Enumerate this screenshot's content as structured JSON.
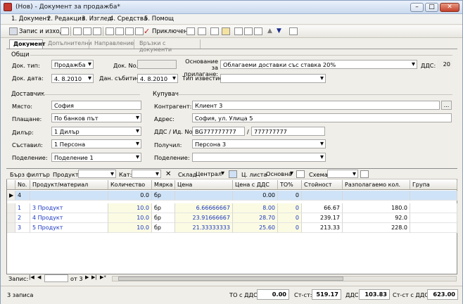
{
  "window": {
    "title": "(Нов) - Документ за продажба*"
  },
  "menu": [
    "1. Документ",
    "2. Редакция",
    "3. Изглед",
    "4. Средства",
    "5. Помощ"
  ],
  "toolbar": {
    "save_close": "Запис и изход",
    "apply": "Приключен"
  },
  "tabs": [
    "Документ",
    "Допълнителни",
    "Направление",
    "Връзки с документи"
  ],
  "general": {
    "section": "Общи",
    "doc_type_label": "Док. тип:",
    "doc_type": "Продажба",
    "doc_no_label": "Док. No.",
    "doc_no": "",
    "basis_label": "Основание за прилагане:",
    "basis": "Облагаеми доставки със ставка 20%",
    "vat_label": "ДДС:",
    "vat": "20",
    "doc_date_label": "Док. дата:",
    "doc_date": "4. 8.2010",
    "tax_event_label": "Дан. събитие:",
    "tax_event": "4. 8.2010",
    "notice_type_label": "Тип известие:",
    "notice_type": ""
  },
  "supplier": {
    "section": "Доставчик",
    "place_label": "Място:",
    "place": "София",
    "payment_label": "Плащане:",
    "payment": "По банков път",
    "dealer_label": "Дилър:",
    "dealer": "1 Дилър",
    "creator_label": "Съставил:",
    "creator": "1 Персона",
    "division_label": "Поделение:",
    "division": "Поделение 1"
  },
  "buyer": {
    "section": "Купувач",
    "contractor_label": "Контрагент:",
    "contractor": "Клиент 3",
    "address_label": "Адрес:",
    "address": "София, ул. Улица 5",
    "vat_id_label": "ДДС / Ид. No.",
    "vat_id": "BG777777777",
    "id_sep": "/",
    "id_no": "777777777",
    "receiver_label": "Получил:",
    "receiver": "Персона 3",
    "division_label": "Поделение:",
    "division": ""
  },
  "filter": {
    "quick_filter": "Бърз филтър",
    "product_label": "Продукт:",
    "category_label": "Кат:",
    "warehouse_label": "Склад",
    "warehouse": "Централ",
    "price_list_label": "Ц. листа",
    "price_list": "Основна",
    "scheme_label": "Схема",
    "close_symbol": "✕"
  },
  "grid": {
    "columns": [
      "No.",
      "Продукт/материал",
      "Количество",
      "Мярка",
      "Цена",
      "Цена с ДДС",
      "ТО%",
      "Стойност",
      "Разполагаемо кол.",
      "Група"
    ],
    "new_row": [
      "4",
      "",
      "0.0",
      "бр",
      "",
      "0.00",
      "0",
      "",
      "",
      ""
    ],
    "rows": [
      [
        "1",
        "3 Продукт",
        "10.0",
        "бр",
        "6.66666667",
        "8.00",
        "0",
        "66.67",
        "180.0",
        ""
      ],
      [
        "2",
        "4 Продукт",
        "10.0",
        "бр",
        "23.91666667",
        "28.70",
        "0",
        "239.17",
        "92.0",
        ""
      ],
      [
        "3",
        "5 Продукт",
        "10.0",
        "бр",
        "21.33333333",
        "25.60",
        "0",
        "213.33",
        "228.0",
        ""
      ]
    ]
  },
  "navigator": {
    "record_label": "Запис:",
    "of_label": "от 3"
  },
  "status": {
    "records": "3 записа",
    "to_vat_label": "ТО с ДДС:",
    "to_vat": "0.00",
    "value_label": "Ст-ст:",
    "value": "519.17",
    "vat_label": "ДДС:",
    "vat": "103.83",
    "value_vat_label": "Ст-ст с ДДС:",
    "value_vat": "623.00"
  }
}
